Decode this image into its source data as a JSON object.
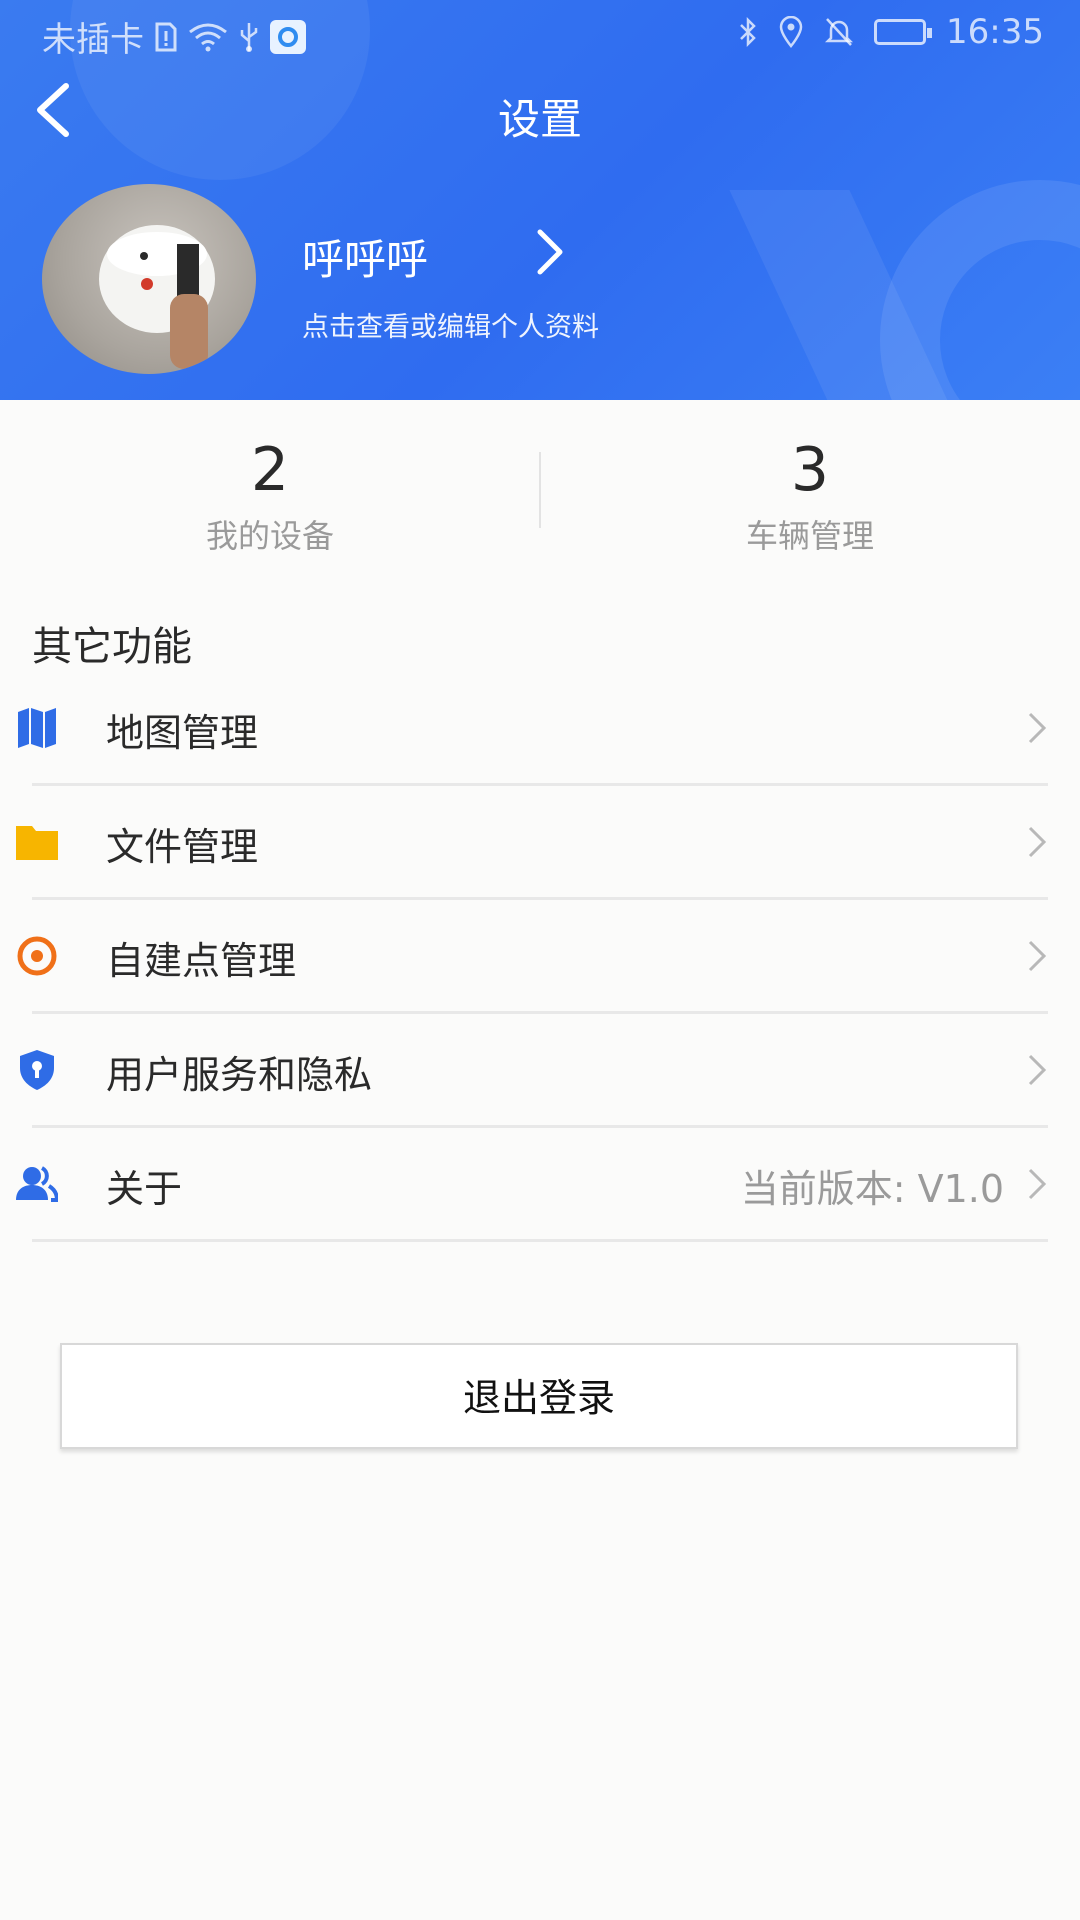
{
  "status_bar": {
    "carrier": "未插卡",
    "time": "16:35",
    "icons_left": [
      "sim-alert-icon",
      "wifi-icon",
      "usb-icon",
      "app-notification-icon"
    ],
    "icons_right": [
      "bluetooth-icon",
      "location-icon",
      "bell-off-icon",
      "battery-charging-icon"
    ]
  },
  "header": {
    "title": "设置",
    "back_icon": "chevron-left-icon"
  },
  "profile": {
    "name": "呼呼呼",
    "hint": "点击查看或编辑个人资料"
  },
  "stats": [
    {
      "value": "2",
      "label": "我的设备"
    },
    {
      "value": "3",
      "label": "车辆管理"
    }
  ],
  "section": {
    "title": "其它功能"
  },
  "menu": [
    {
      "label": "地图管理",
      "icon": "map-icon",
      "icon_color": "#2f6ce6"
    },
    {
      "label": "文件管理",
      "icon": "folder-icon",
      "icon_color": "#f7b500"
    },
    {
      "label": "自建点管理",
      "icon": "target-icon",
      "icon_color": "#f07018"
    },
    {
      "label": "用户服务和隐私",
      "icon": "shield-keyhole-icon",
      "icon_color": "#2f6ce6"
    },
    {
      "label": "关于",
      "icon": "user-group-icon",
      "icon_color": "#2f6ce6",
      "value": "当前版本: V1.0"
    }
  ],
  "logout": {
    "label": "退出登录"
  },
  "colors": {
    "header_blue": "#2f6cf0",
    "background": "#fbfbfa",
    "divider": "#e8e8e8",
    "muted_text": "#9a9a9a"
  }
}
